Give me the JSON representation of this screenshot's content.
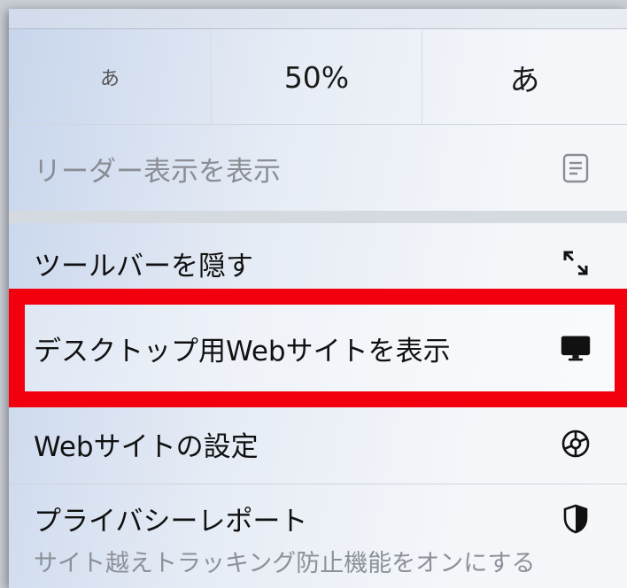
{
  "font_size_control": {
    "smaller_label": "あ",
    "zoom_value": "50%",
    "larger_label": "あ"
  },
  "menu": {
    "reader_view": "リーダー表示を表示",
    "hide_toolbar": "ツールバーを隠す",
    "desktop_site": "デスクトップ用Webサイトを表示",
    "website_settings": "Webサイトの設定",
    "privacy_report": "プライバシーレポート",
    "privacy_report_sub": "サイト越えトラッキング防止機能をオンにする"
  },
  "icons": {
    "reader": "reader-icon",
    "hide_toolbar": "expand-arrows-icon",
    "desktop": "desktop-icon",
    "settings": "gear-icon",
    "privacy": "shield-icon"
  },
  "colors": {
    "highlight": "#f2000d",
    "disabled_text": "#8a8d94"
  }
}
